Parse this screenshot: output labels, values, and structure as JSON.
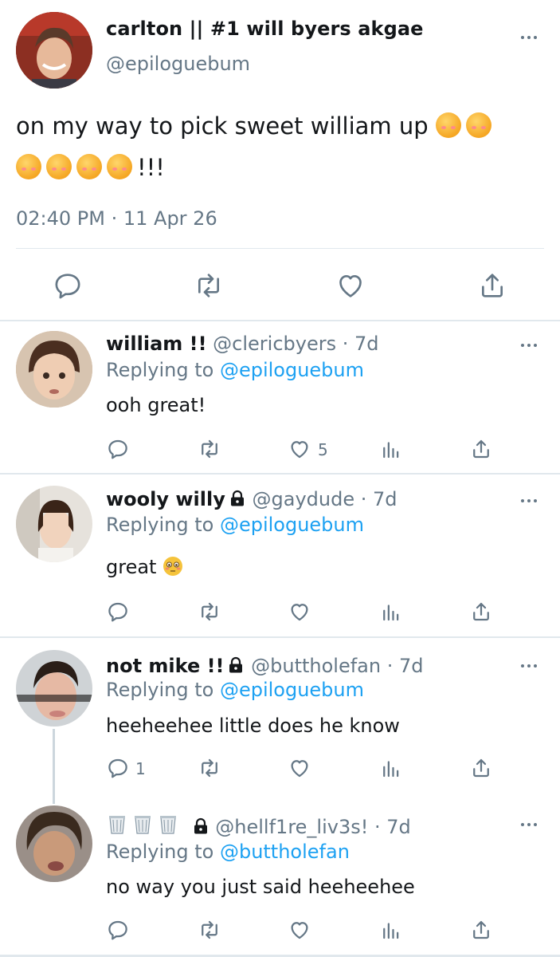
{
  "main_tweet": {
    "display_name": "carlton || #1 will byers akgae",
    "handle": "@epiloguebum",
    "text_part1": "on my way to pick sweet william up",
    "text_part2": "!!!",
    "emoji_name": "smiling-face-with-hearts",
    "timestamp": "02:40 PM · 11 Apr 26"
  },
  "icons": {
    "reply": "reply-icon",
    "retweet": "retweet-icon",
    "like": "heart-icon",
    "share": "share-icon",
    "analytics": "analytics-icon",
    "more": "more-options-icon",
    "lock": "lock-icon",
    "trash": "wastebasket-icon"
  },
  "replies": [
    {
      "display_name": "william !!",
      "handle": "@clericbyers",
      "age": "· 7d",
      "replying_prefix": "Replying to",
      "replying_to": "@epiloguebum",
      "text": "ooh great!",
      "like_count": "5",
      "reply_count": ""
    },
    {
      "display_name": "wooly willy",
      "handle": "@gaydude",
      "age": "· 7d",
      "replying_prefix": "Replying to",
      "replying_to": "@epiloguebum",
      "text": "great",
      "text_emoji": "flushed-face",
      "like_count": "",
      "reply_count": ""
    },
    {
      "display_name": "not mike !!",
      "handle": "@buttholefan",
      "age": "· 7d",
      "replying_prefix": "Replying to",
      "replying_to": "@epiloguebum",
      "text": "heeheehee little does he know",
      "like_count": "",
      "reply_count": "1"
    },
    {
      "display_name": "",
      "handle": "@hellf1re_liv3s!",
      "age": "· 7d",
      "replying_prefix": "Replying to",
      "replying_to": "@buttholefan",
      "text": "no way you just said heeheehee",
      "like_count": "",
      "reply_count": ""
    }
  ],
  "colors": {
    "link": "#1da1f2",
    "muted": "#657786",
    "divider": "#e1e8ed",
    "text": "#14171a"
  }
}
